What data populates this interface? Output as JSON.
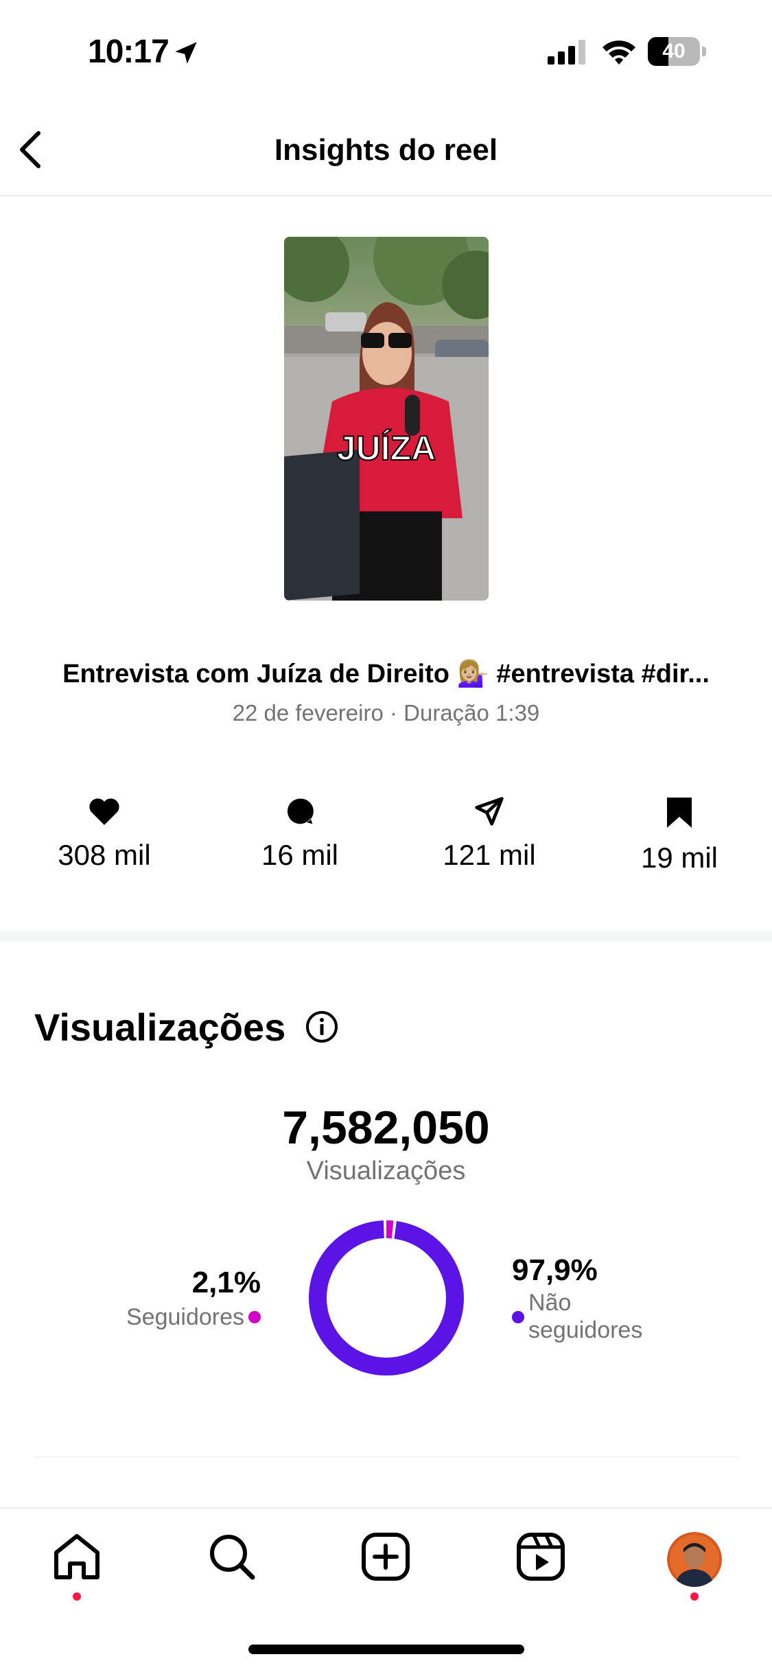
{
  "status_bar": {
    "time": "10:17",
    "battery_percent": 40,
    "battery_label": "40",
    "icons": [
      "location-arrow-icon",
      "cellular-signal-icon",
      "wifi-icon",
      "battery-icon"
    ]
  },
  "header": {
    "title": "Insights do reel",
    "back_icon": "chevron-left-icon"
  },
  "reel": {
    "thumbnail_overlay_text": "JUÍZA",
    "title": "Entrevista com Juíza de Direito 💁🏼‍♀️ #entrevista #dir...",
    "meta": "22 de fevereiro · Duração 1:39"
  },
  "stats": {
    "likes": "308 mil",
    "comments": "16 mil",
    "shares": "121 mil",
    "saves": "19 mil",
    "icons": [
      "heart-icon",
      "comment-icon",
      "send-icon",
      "bookmark-icon"
    ]
  },
  "views": {
    "heading": "Visualizações",
    "total": "7,582,050",
    "total_label": "Visualizações",
    "followers_pct_label": "2,1%",
    "followers_label": "Seguidores",
    "non_followers_pct_label": "97,9%",
    "non_followers_label_line1": "Não",
    "non_followers_label_line2": "seguidores"
  },
  "chart_data": {
    "type": "pie",
    "style": "donut",
    "categories": [
      "Seguidores",
      "Não seguidores"
    ],
    "values": [
      2.1,
      97.9
    ],
    "colors": [
      "#d300c5",
      "#5b13e6"
    ]
  },
  "tab_bar": {
    "tabs": [
      "home-icon",
      "search-icon",
      "create-icon",
      "reels-icon",
      "profile-avatar"
    ]
  },
  "colors": {
    "followers": "#d300c5",
    "non_followers": "#5b13e6",
    "notification_dot": "#ff1744",
    "secondary_text": "#737373"
  }
}
